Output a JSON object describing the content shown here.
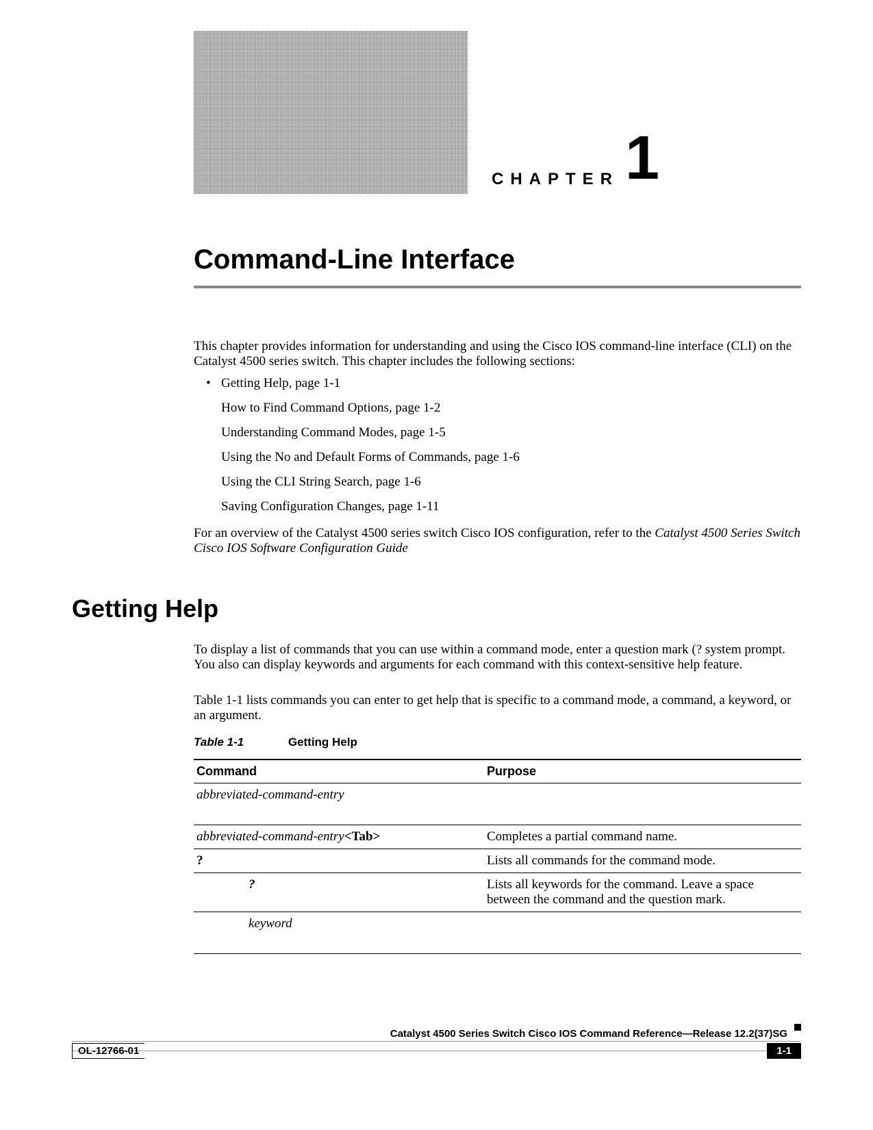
{
  "chapter": {
    "label": "CHAPTER",
    "number": "1",
    "title": "Command-Line Interface"
  },
  "intro": "This chapter provides information for understanding and using the Cisco IOS command-line interface (CLI) on the Catalyst 4500 series switch. This chapter includes the following sections:",
  "toc": [
    "Getting Help, page 1-1",
    "How to Find Command Options, page 1-2",
    "Understanding Command Modes, page 1-5",
    "Using the No and Default Forms of Commands, page 1-6",
    "Using the CLI String Search, page 1-6",
    "Saving Configuration Changes, page 1-11"
  ],
  "overview_pre": "For an overview of the Catalyst 4500 series switch Cisco IOS configuration, refer to the ",
  "overview_italic": "Catalyst 4500 Series Switch Cisco IOS Software Configuration Guide",
  "section_h1": "Getting Help",
  "para2": "To display a list of commands that you can use within a command mode, enter a question mark (? system prompt. You also can display keywords and arguments for each command with this context-sensitive help feature.",
  "para3": "Table 1-1 lists commands you can enter to get help that is specific to a command mode, a command, a keyword, or an argument.",
  "table": {
    "caption_num": "Table 1-1",
    "caption_title": "Getting Help",
    "headers": [
      "Command",
      "Purpose"
    ],
    "rows": [
      {
        "cmd_italic": "abbreviated-command-entry",
        "cmd_bold": "",
        "purpose": " ",
        "tall": true
      },
      {
        "cmd_italic": "abbreviated-command-entry",
        "cmd_bold": "<Tab>",
        "purpose": "Completes a partial command name."
      },
      {
        "cmd_italic": "",
        "cmd_bold": "?",
        "purpose": "Lists all commands for the command mode."
      },
      {
        "cmd_italic": "",
        "cmd_bold": "?",
        "indent": true,
        "purpose": "Lists all keywords for the command. Leave a space between the command and the question mark."
      },
      {
        "cmd_italic": "keyword",
        "cmd_bold": "",
        "indent": true,
        "purpose": " ",
        "tall": true
      }
    ]
  },
  "footer": {
    "reference": "Catalyst 4500 Series Switch Cisco IOS Command Reference—Release 12.2(37)SG",
    "doc_id": "OL-12766-01",
    "page_num": "1-1"
  }
}
